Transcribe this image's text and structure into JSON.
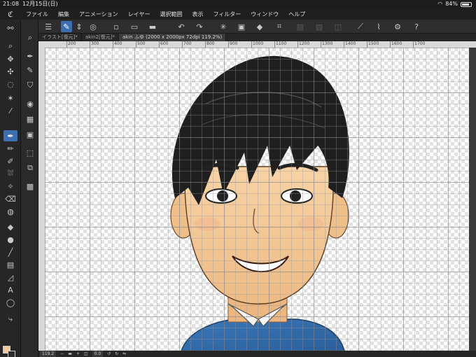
{
  "status": {
    "time": "21:08",
    "date": "12月15日(日)",
    "battery": "84%",
    "battery_level": 0.84
  },
  "menu": {
    "items": [
      "ファイル",
      "編集",
      "アニメーション",
      "レイヤー",
      "選択範囲",
      "表示",
      "フィルター",
      "ウィンドウ",
      "ヘルプ"
    ]
  },
  "tabs": [
    {
      "label": "イラスト[復元]*"
    },
    {
      "label": "akin2[復元]*"
    },
    {
      "label": "akin ふゆ (2000 x 2000px 72dpi 119.2%)"
    }
  ],
  "ruler": {
    "ticks": [
      "200",
      "300",
      "400",
      "500",
      "600",
      "700",
      "800",
      "900",
      "1000",
      "1100",
      "1200",
      "1300",
      "1400",
      "1500",
      "1600",
      "1700"
    ]
  },
  "bottom": {
    "zoom": "119.2",
    "angle": "0.0"
  },
  "colors": {
    "main_color": "#f5c99a",
    "sub_color": "#2b2b2b",
    "accent": "#3d6fb0"
  }
}
